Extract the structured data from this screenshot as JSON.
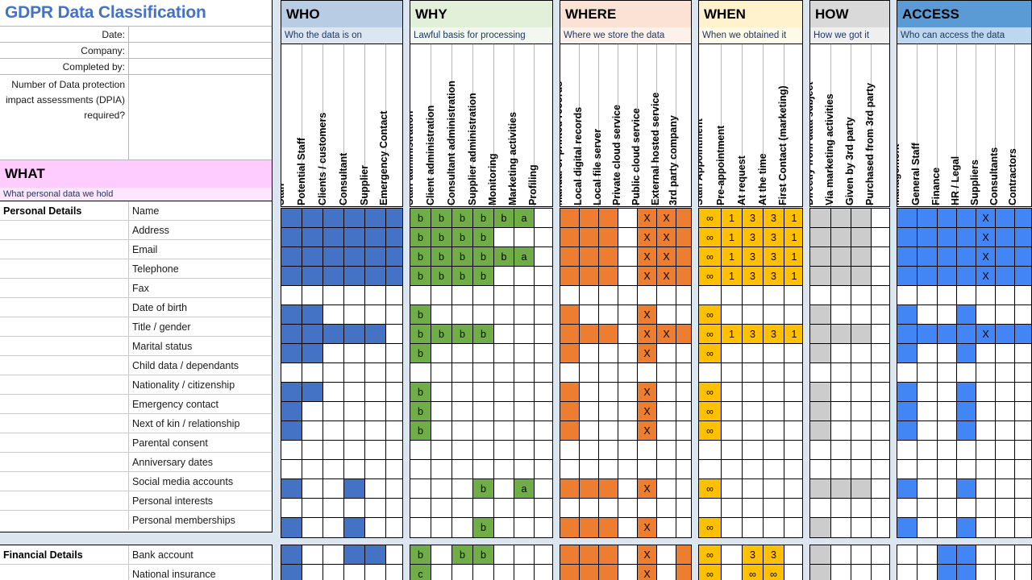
{
  "document": {
    "title": "GDPR Data Classification",
    "meta": [
      {
        "label": "Date:",
        "value": ""
      },
      {
        "label": "Company:",
        "value": ""
      },
      {
        "label": "Completed by:",
        "value": ""
      },
      {
        "label": "Number of Data protection impact assessments (DPIA) required?",
        "value": ""
      }
    ]
  },
  "what": {
    "heading": "WHAT",
    "subheading": "What personal data we hold"
  },
  "sections": [
    {
      "key": "who",
      "heading": "WHO",
      "subheading": "Who the data is on",
      "header_bg": "#B8CCE4",
      "sub_bg": "#DCE6F1",
      "columns": [
        "Staff",
        "Potential Staff",
        "Clients / customers",
        "Consultant",
        "Supplier",
        "Emergency Contact"
      ]
    },
    {
      "key": "why",
      "heading": "WHY",
      "subheading": "Lawful basis for processing",
      "header_bg": "#E2EFD9",
      "sub_bg": "#F2F8EF",
      "columns": [
        "Staff administration",
        "Client administration",
        "Consultant administration",
        "Supplier administration",
        "Monitoring",
        "Marketing activities",
        "Profiling"
      ]
    },
    {
      "key": "where",
      "heading": "WHERE",
      "subheading": "Where we store the data",
      "header_bg": "#FBE2D5",
      "sub_bg": "#FDF1EB",
      "columns": [
        "Manual or printed records",
        "Local digital records",
        "Local file server",
        "Private cloud service",
        "Public cloud service",
        "External hosted service",
        "3rd party company"
      ]
    },
    {
      "key": "when",
      "heading": "WHEN",
      "subheading": "When we obtained it",
      "header_bg": "#FFF2CC",
      "sub_bg": "#FFF9E8",
      "columns": [
        "Staff Appointment",
        "Pre-appointment",
        "At request",
        "At the time",
        "First Contact (marketing)"
      ]
    },
    {
      "key": "how",
      "heading": "HOW",
      "subheading": "How we got it",
      "header_bg": "#D9D9D9",
      "sub_bg": "#EFEFEF",
      "columns": [
        "Directly from data subject",
        "Via marketing activities",
        "Given by 3rd party",
        "Purchased from 3rd party"
      ]
    },
    {
      "key": "access",
      "heading": "ACCESS",
      "subheading": "Who can access the data",
      "header_bg": "#5B9BD5",
      "sub_bg": "#BDD7EE",
      "columns": [
        "Management",
        "General Staff",
        "Finance",
        "HR / Legal",
        "Suppliers",
        "Consultants",
        "Contractors"
      ]
    }
  ],
  "groups": [
    {
      "name": "Personal Details",
      "rows": [
        {
          "label": "Name",
          "who": [
            "f-blue",
            "f-blue",
            "f-blue",
            "f-blue",
            "f-blue",
            "f-blue"
          ],
          "why": [
            "b",
            "b",
            "b",
            "b",
            "b",
            "a",
            ""
          ],
          "where": [
            "f",
            "f",
            "f",
            "",
            "X",
            "X",
            "f"
          ],
          "when": [
            "∞",
            "1",
            "3",
            "3",
            "1"
          ],
          "how": [
            "f",
            "f",
            "f",
            ""
          ],
          "access": [
            "f",
            "f",
            "f",
            "f",
            "X",
            "f",
            "f"
          ]
        },
        {
          "label": "Address",
          "who": [
            "f-blue",
            "f-blue",
            "f-blue",
            "f-blue",
            "f-blue",
            "f-blue"
          ],
          "why": [
            "b",
            "b",
            "b",
            "b",
            "",
            "",
            ""
          ],
          "where": [
            "f",
            "f",
            "f",
            "",
            "X",
            "X",
            "f"
          ],
          "when": [
            "∞",
            "1",
            "3",
            "3",
            "1"
          ],
          "how": [
            "f",
            "f",
            "f",
            ""
          ],
          "access": [
            "f",
            "f",
            "f",
            "f",
            "X",
            "f",
            "f"
          ]
        },
        {
          "label": "Email",
          "who": [
            "f-blue",
            "f-blue",
            "f-blue",
            "f-blue",
            "f-blue",
            "f-blue"
          ],
          "why": [
            "b",
            "b",
            "b",
            "b",
            "b",
            "a",
            ""
          ],
          "where": [
            "f",
            "f",
            "f",
            "",
            "X",
            "X",
            "f"
          ],
          "when": [
            "∞",
            "1",
            "3",
            "3",
            "1"
          ],
          "how": [
            "f",
            "f",
            "f",
            ""
          ],
          "access": [
            "f",
            "f",
            "f",
            "f",
            "X",
            "f",
            "f"
          ]
        },
        {
          "label": "Telephone",
          "who": [
            "f-blue",
            "f-blue",
            "f-blue",
            "f-blue",
            "f-blue",
            "f-blue"
          ],
          "why": [
            "b",
            "b",
            "b",
            "b",
            "",
            "",
            ""
          ],
          "where": [
            "f",
            "f",
            "f",
            "",
            "X",
            "X",
            "f"
          ],
          "when": [
            "∞",
            "1",
            "3",
            "3",
            "1"
          ],
          "how": [
            "f",
            "f",
            "f",
            ""
          ],
          "access": [
            "f",
            "f",
            "f",
            "f",
            "X",
            "f",
            "f"
          ]
        },
        {
          "label": "Fax",
          "who": [
            "",
            "",
            "",
            "",
            "",
            ""
          ],
          "why": [
            "",
            "",
            "",
            "",
            "",
            "",
            ""
          ],
          "where": [
            "",
            "",
            "",
            "",
            "",
            "",
            ""
          ],
          "when": [
            "",
            "",
            "",
            "",
            ""
          ],
          "how": [
            "",
            "",
            "",
            ""
          ],
          "access": [
            "",
            "",
            "",
            "",
            "",
            "",
            ""
          ]
        },
        {
          "label": "Date of birth",
          "who": [
            "f-blue",
            "f-blue",
            "",
            "",
            "",
            ""
          ],
          "why": [
            "b",
            "",
            "",
            "",
            "",
            "",
            ""
          ],
          "where": [
            "f",
            "",
            "",
            "",
            "X",
            "",
            ""
          ],
          "when": [
            "∞",
            "",
            "",
            "",
            ""
          ],
          "how": [
            "f",
            "",
            "",
            ""
          ],
          "access": [
            "f",
            "",
            "",
            "f",
            "",
            "",
            ""
          ]
        },
        {
          "label": "Title / gender",
          "who": [
            "f-blue",
            "f-blue",
            "f-blue",
            "f-blue",
            "f-blue",
            ""
          ],
          "why": [
            "b",
            "b",
            "b",
            "b",
            "",
            "",
            ""
          ],
          "where": [
            "f",
            "f",
            "f",
            "",
            "X",
            "X",
            "f"
          ],
          "when": [
            "∞",
            "1",
            "3",
            "3",
            "1"
          ],
          "how": [
            "f",
            "f",
            "f",
            ""
          ],
          "access": [
            "f",
            "f",
            "f",
            "f",
            "X",
            "f",
            "f"
          ]
        },
        {
          "label": "Marital status",
          "who": [
            "f-blue",
            "f-blue",
            "",
            "",
            "",
            ""
          ],
          "why": [
            "b",
            "",
            "",
            "",
            "",
            "",
            ""
          ],
          "where": [
            "f",
            "",
            "",
            "",
            "X",
            "",
            ""
          ],
          "when": [
            "∞",
            "",
            "",
            "",
            ""
          ],
          "how": [
            "f",
            "",
            "",
            ""
          ],
          "access": [
            "f",
            "",
            "",
            "f",
            "",
            "",
            ""
          ]
        },
        {
          "label": "Child data / dependants",
          "who": [
            "",
            "",
            "",
            "",
            "",
            ""
          ],
          "why": [
            "",
            "",
            "",
            "",
            "",
            "",
            ""
          ],
          "where": [
            "",
            "",
            "",
            "",
            "",
            "",
            ""
          ],
          "when": [
            "",
            "",
            "",
            "",
            ""
          ],
          "how": [
            "",
            "",
            "",
            ""
          ],
          "access": [
            "",
            "",
            "",
            "",
            "",
            "",
            ""
          ]
        },
        {
          "label": "Nationality / citizenship",
          "who": [
            "f-blue",
            "f-blue",
            "",
            "",
            "",
            ""
          ],
          "why": [
            "b",
            "",
            "",
            "",
            "",
            "",
            ""
          ],
          "where": [
            "f",
            "",
            "",
            "",
            "X",
            "",
            ""
          ],
          "when": [
            "∞",
            "",
            "",
            "",
            ""
          ],
          "how": [
            "f",
            "",
            "",
            ""
          ],
          "access": [
            "f",
            "",
            "",
            "f",
            "",
            "",
            ""
          ]
        },
        {
          "label": "Emergency contact",
          "who": [
            "f-blue",
            "",
            "",
            "",
            "",
            ""
          ],
          "why": [
            "b",
            "",
            "",
            "",
            "",
            "",
            ""
          ],
          "where": [
            "f",
            "",
            "",
            "",
            "X",
            "",
            ""
          ],
          "when": [
            "∞",
            "",
            "",
            "",
            ""
          ],
          "how": [
            "f",
            "",
            "",
            ""
          ],
          "access": [
            "f",
            "",
            "",
            "f",
            "",
            "",
            ""
          ]
        },
        {
          "label": "Next of kin / relationship",
          "who": [
            "f-blue",
            "",
            "",
            "",
            "",
            ""
          ],
          "why": [
            "b",
            "",
            "",
            "",
            "",
            "",
            ""
          ],
          "where": [
            "f",
            "",
            "",
            "",
            "X",
            "",
            ""
          ],
          "when": [
            "∞",
            "",
            "",
            "",
            ""
          ],
          "how": [
            "f",
            "",
            "",
            ""
          ],
          "access": [
            "f",
            "",
            "",
            "f",
            "",
            "",
            ""
          ]
        },
        {
          "label": "Parental consent",
          "who": [
            "",
            "",
            "",
            "",
            "",
            ""
          ],
          "why": [
            "",
            "",
            "",
            "",
            "",
            "",
            ""
          ],
          "where": [
            "",
            "",
            "",
            "",
            "",
            "",
            ""
          ],
          "when": [
            "",
            "",
            "",
            "",
            ""
          ],
          "how": [
            "",
            "",
            "",
            ""
          ],
          "access": [
            "",
            "",
            "",
            "",
            "",
            "",
            ""
          ]
        },
        {
          "label": "Anniversary dates",
          "who": [
            "",
            "",
            "",
            "",
            "",
            ""
          ],
          "why": [
            "",
            "",
            "",
            "",
            "",
            "",
            ""
          ],
          "where": [
            "",
            "",
            "",
            "",
            "",
            "",
            ""
          ],
          "when": [
            "",
            "",
            "",
            "",
            ""
          ],
          "how": [
            "",
            "",
            "",
            ""
          ],
          "access": [
            "",
            "",
            "",
            "",
            "",
            "",
            ""
          ]
        },
        {
          "label": "Social media accounts",
          "who": [
            "f-blue",
            "",
            "",
            "f-blue",
            "",
            ""
          ],
          "why": [
            "",
            "",
            "",
            "b",
            "",
            "a",
            ""
          ],
          "where": [
            "f",
            "f",
            "f",
            "",
            "X",
            "",
            ""
          ],
          "when": [
            "∞",
            "",
            "",
            "",
            ""
          ],
          "how": [
            "f",
            "f",
            "f",
            ""
          ],
          "access": [
            "f",
            "",
            "",
            "f",
            "",
            "",
            ""
          ]
        },
        {
          "label": "Personal interests",
          "who": [
            "",
            "",
            "",
            "",
            "",
            ""
          ],
          "why": [
            "",
            "",
            "",
            "",
            "",
            "",
            ""
          ],
          "where": [
            "",
            "",
            "",
            "",
            "",
            "",
            ""
          ],
          "when": [
            "",
            "",
            "",
            "",
            ""
          ],
          "how": [
            "",
            "",
            "",
            ""
          ],
          "access": [
            "",
            "",
            "",
            "",
            "",
            "",
            ""
          ]
        },
        {
          "label": "Personal memberships",
          "who": [
            "f-blue",
            "",
            "",
            "f-blue",
            "",
            ""
          ],
          "why": [
            "",
            "",
            "",
            "b",
            "",
            "",
            ""
          ],
          "where": [
            "f",
            "f",
            "f",
            "",
            "X",
            "",
            ""
          ],
          "when": [
            "∞",
            "",
            "",
            "",
            ""
          ],
          "how": [
            "f",
            "",
            "",
            ""
          ],
          "access": [
            "f",
            "",
            "",
            "f",
            "",
            "",
            ""
          ]
        }
      ]
    },
    {
      "name": "Financial Details",
      "rows": [
        {
          "label": "Bank account",
          "who": [
            "f-blue",
            "",
            "",
            "f-blue",
            "f-blue",
            ""
          ],
          "why": [
            "b",
            "",
            "b",
            "b",
            "",
            "",
            ""
          ],
          "where": [
            "f",
            "f",
            "f",
            "",
            "X",
            "",
            "f"
          ],
          "when": [
            "∞",
            "",
            "3",
            "3",
            ""
          ],
          "how": [
            "f",
            "",
            "",
            ""
          ],
          "access": [
            "",
            "",
            "f",
            "f",
            "",
            "",
            ""
          ]
        },
        {
          "label": "National insurance",
          "who": [
            "f-blue",
            "",
            "",
            "",
            "",
            ""
          ],
          "why": [
            "c",
            "",
            "",
            "",
            "",
            "",
            ""
          ],
          "where": [
            "f",
            "f",
            "f",
            "",
            "X",
            "",
            "f"
          ],
          "when": [
            "∞",
            "",
            "∞",
            "∞",
            ""
          ],
          "how": [
            "f",
            "",
            "",
            ""
          ],
          "access": [
            "",
            "",
            "f",
            "f",
            "",
            "",
            ""
          ]
        }
      ]
    }
  ]
}
